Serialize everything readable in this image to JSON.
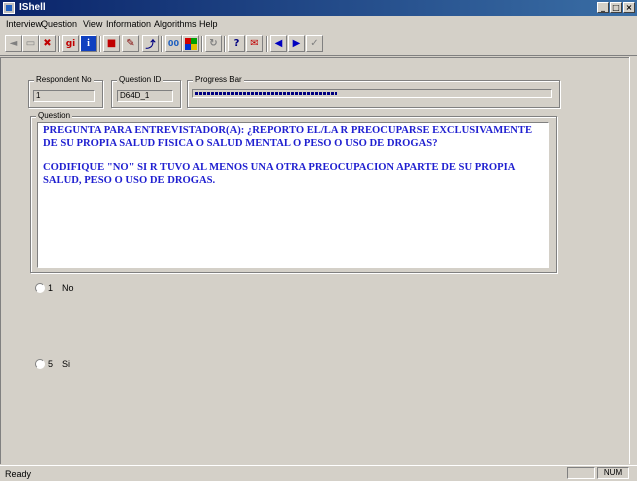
{
  "window": {
    "title": "IShell"
  },
  "menu": [
    {
      "label": "Interview",
      "key": "I"
    },
    {
      "label": "Question",
      "key": "Q"
    },
    {
      "label": "View",
      "key": "V"
    },
    {
      "label": "Information",
      "key": "I"
    },
    {
      "label": "Algorithms",
      "key": "A"
    },
    {
      "label": "Help",
      "key": "H"
    }
  ],
  "toolbar": {
    "icons": [
      "back-icon",
      "blank-icon",
      "cancel-icon",
      "help-gi-icon",
      "info-icon",
      "red-square-icon",
      "edit-icon",
      "jump-icon",
      "stats-icon",
      "color-palette-icon",
      "refresh-icon",
      "question-mark-icon",
      "note-icon",
      "previous-icon",
      "next-icon",
      "check-icon"
    ],
    "help_label": "gi",
    "info_glyph": "i",
    "stats_label": "00",
    "question_glyph": "?"
  },
  "header": {
    "respondent_label": "Respondent No",
    "respondent_value": "1",
    "question_id_label": "Question ID",
    "question_id_value": "D64D_1",
    "progress_label": "Progress Bar",
    "progress_fraction": 0.4
  },
  "question": {
    "label": "Question",
    "paragraph1": "PREGUNTA PARA ENTREVISTADOR(A):  ¿REPORTO EL/LA R PREOCUPARSE EXCLUSIVAMENTE DE SU PROPIA SALUD FISICA O SALUD MENTAL O PESO O USO DE DROGAS?",
    "paragraph2": "CODIFIQUE \"NO\" SI R TUVO AL MENOS UNA OTRA PREOCUPACION APARTE DE SU PROPIA SALUD, PESO O USO DE DROGAS."
  },
  "options": [
    {
      "code": "1",
      "label": "No"
    },
    {
      "code": "5",
      "label": "Si"
    }
  ],
  "status": {
    "text": "Ready",
    "num": "NUM"
  }
}
